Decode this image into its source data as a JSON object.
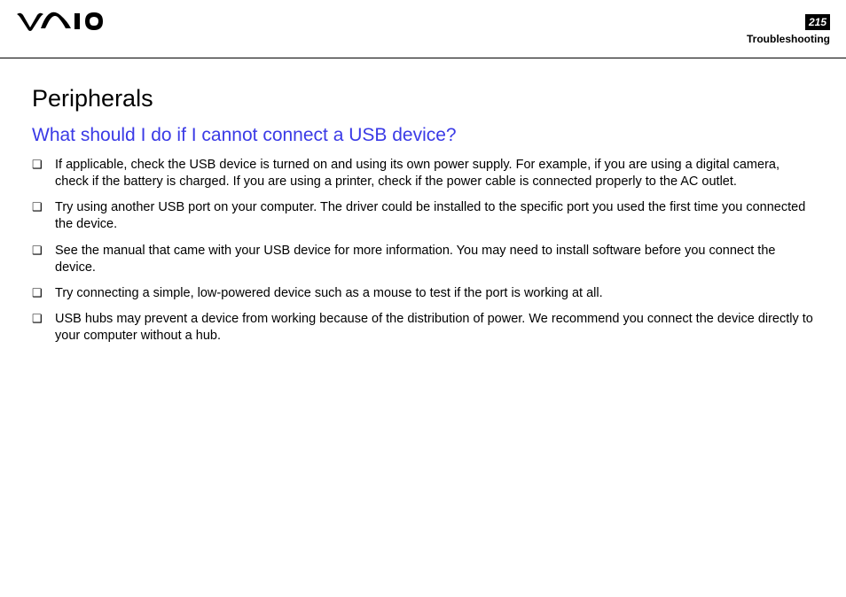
{
  "header": {
    "page_number": "215",
    "section": "Troubleshooting"
  },
  "content": {
    "title": "Peripherals",
    "subtitle": "What should I do if I cannot connect a USB device?",
    "bullets": [
      "If applicable, check the USB device is turned on and using its own power supply. For example, if you are using a digital camera, check if the battery is charged. If you are using a printer, check if the power cable is connected properly to the AC outlet.",
      "Try using another USB port on your computer. The driver could be installed to the specific port you used the first time you connected the device.",
      "See the manual that came with your USB device for more information. You may need to install software before you connect the device.",
      "Try connecting a simple, low-powered device such as a mouse to test if the port is working at all.",
      "USB hubs may prevent a device from working because of the distribution of power. We recommend you connect the device directly to your computer without a hub."
    ]
  }
}
